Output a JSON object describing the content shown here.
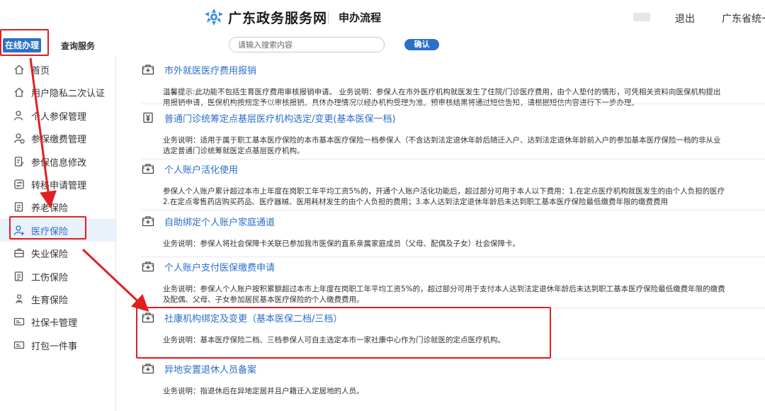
{
  "header": {
    "site_title": "广东政务服务网",
    "subtitle": "申办流程",
    "logout": "退出",
    "region": "广东省统一"
  },
  "tabs": {
    "online": "在线办理",
    "query": "查询服务"
  },
  "search": {
    "placeholder": "请输入搜索内容",
    "confirm": "确认"
  },
  "sidebar": {
    "items": [
      {
        "label": "首页",
        "icon": "home-icon"
      },
      {
        "label": "用户隐私二次认证",
        "icon": "home-icon"
      },
      {
        "label": "个人参保管理",
        "icon": "user-icon"
      },
      {
        "label": "参保缴费管理",
        "icon": "payment-icon"
      },
      {
        "label": "参保信息修改",
        "icon": "edit-doc-icon"
      },
      {
        "label": "转移申请管理",
        "icon": "transfer-icon"
      },
      {
        "label": "养老保险",
        "icon": "document-icon"
      },
      {
        "label": "医疗保险",
        "icon": "medical-user-icon",
        "active": true
      },
      {
        "label": "失业保险",
        "icon": "briefcase-icon"
      },
      {
        "label": "工伤保险",
        "icon": "document-icon"
      },
      {
        "label": "生育保险",
        "icon": "baby-icon"
      },
      {
        "label": "社保卡管理",
        "icon": "card-icon"
      },
      {
        "label": "打包一件事",
        "icon": "card-icon"
      }
    ]
  },
  "services": [
    {
      "title": "市外就医医疗费用报销",
      "icon": "medical-kit-icon",
      "lines": [
        "温馨提示:此功能不包括生育医疗费用审核报销申请。 业务说明：参保人在市外医疗机构就医发生了住院/门诊医疗费用，由个人垫付的情形，可凭相关资料向医保机构提出",
        "用报销申请，医保机构按规定予以审核报销。具体办理情况以经办机构受理为准。预审核结果将通过短信告知，请根据短信内容进行下一步办理。"
      ]
    },
    {
      "title": "普通门诊统筹定点基层医疗机构选定/变更(基本医保一档)",
      "icon": "yuan-doc-icon",
      "lines": [
        "业务说明：适用于属于职工基本医疗保险的本市基本医疗保险一档参保人（不含达到法定退休年龄后随迁入户、达到法定退休年龄前入户的参加基本医疗保险一档的非从业",
        "选定普通门诊统筹就医定点基层医疗机构。"
      ]
    },
    {
      "title": "个人账户活化使用",
      "icon": "medical-kit-icon",
      "lines": [
        "参保人个人账户累计超过本市上年度在岗职工年平均工资5%的，开通个人账户活化功能后，超过部分可用于本人以下费用：1.在定点医疗机构就医发生的由个人负担的医疗",
        "2.在定点零售药店购买药品、医疗器械、医用耗材发生的由个人负担的费用；3.本人达到法定退休年龄后未达到职工基本医疗保险最低缴费年限的缴费费用"
      ]
    },
    {
      "title": "自助绑定个人账户家庭通道",
      "icon": "medical-kit-icon",
      "lines": [
        "业务说明：参保人将社会保障卡关联已参加我市医保的直系亲属家庭成员（父母、配偶及子女）社会保障卡。"
      ]
    },
    {
      "title": "个人账户支付医保缴费申请",
      "icon": "medical-kit-icon",
      "lines": [
        "业务说明：参保人个人账户按积累额超过本市上年度在岗职工年平均工资5%的，超过部分可用于支付本人达到法定退休年龄后未达到职工基本医疗保险最低缴费年限的缴费",
        "及配偶、父母、子女参加居民基本医疗保险的个人缴费费用。"
      ]
    },
    {
      "title": "社康机构绑定及变更（基本医保二档/三档）",
      "icon": "medical-kit-icon",
      "lines": [
        "业务说明：基本医疗保险二档、三档参保人可自主选定本市一家社康中心作为门诊就医的定点医疗机构。"
      ]
    },
    {
      "title": "异地安置退休人员备案",
      "icon": "medical-kit-icon",
      "lines": [
        "业务说明：指退休后在异地定居并且户籍迁入定居地的人员。"
      ]
    }
  ],
  "colors": {
    "accent": "#2a6fc9",
    "annotation": "#e02020"
  }
}
